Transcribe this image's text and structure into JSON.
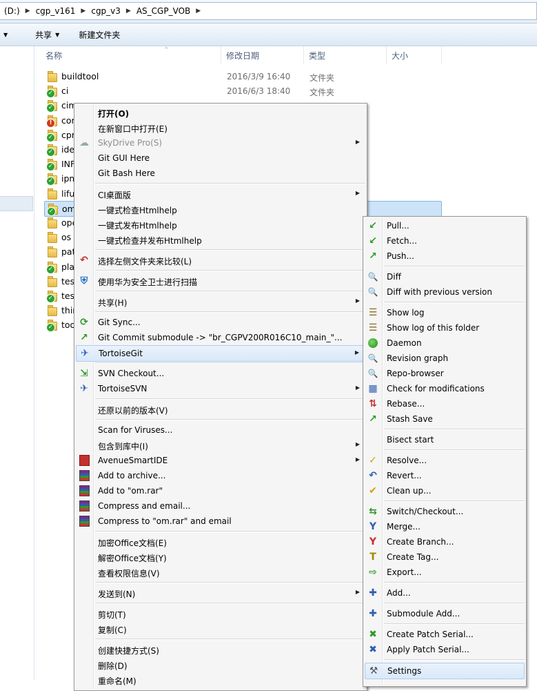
{
  "address": {
    "crumbs": [
      "(D:)",
      "cgp_v161",
      "cgp_v3",
      "AS_CGP_VOB"
    ]
  },
  "toolbar": {
    "share_label": "共享",
    "new_folder_label": "新建文件夹"
  },
  "columns": {
    "name": "名称",
    "date": "修改日期",
    "type": "类型",
    "size": "大小"
  },
  "files": [
    {
      "name": "buildtool",
      "date": "2016/3/9 16:40",
      "type": "文件夹",
      "status": "none"
    },
    {
      "name": "ci",
      "date": "2016/6/3 18:40",
      "type": "文件夹",
      "status": "ok"
    },
    {
      "name": "cim",
      "date": "",
      "type": "",
      "status": "ok"
    },
    {
      "name": "cor",
      "date": "",
      "type": "",
      "status": "modified"
    },
    {
      "name": "cpr",
      "date": "",
      "type": "",
      "status": "ok"
    },
    {
      "name": "ide",
      "date": "",
      "type": "",
      "status": "ok"
    },
    {
      "name": "INF",
      "date": "",
      "type": "",
      "status": "ok"
    },
    {
      "name": "ipm",
      "date": "",
      "type": "",
      "status": "ok"
    },
    {
      "name": "lifu",
      "date": "",
      "type": "",
      "status": "none"
    },
    {
      "name": "om",
      "date": "",
      "type": "",
      "status": "ok",
      "selected": true
    },
    {
      "name": "ope",
      "date": "",
      "type": "",
      "status": "none"
    },
    {
      "name": "os",
      "date": "",
      "type": "",
      "status": "none"
    },
    {
      "name": "pat",
      "date": "",
      "type": "",
      "status": "none"
    },
    {
      "name": "pla",
      "date": "",
      "type": "",
      "status": "ok"
    },
    {
      "name": "tes",
      "date": "",
      "type": "",
      "status": "none"
    },
    {
      "name": "tes",
      "date": "",
      "type": "",
      "status": "ok"
    },
    {
      "name": "thir",
      "date": "",
      "type": "",
      "status": "none"
    },
    {
      "name": "too",
      "date": "",
      "type": "",
      "status": "ok"
    }
  ],
  "context_menu": {
    "items": [
      {
        "label": "打开(O)",
        "bold": true,
        "icon": ""
      },
      {
        "label": "在新窗口中打开(E)",
        "icon": ""
      },
      {
        "label": "SkyDrive Pro(S)",
        "disabled": true,
        "submenu": true,
        "icon": "cloud-icon"
      },
      {
        "label": "Git GUI Here",
        "icon": ""
      },
      {
        "label": "Git Bash Here",
        "icon": ""
      },
      {
        "sep": true
      },
      {
        "label": "CI桌面版",
        "submenu": true,
        "icon": ""
      },
      {
        "label": "一键式检查Htmlhelp",
        "icon": ""
      },
      {
        "label": "一键式发布Htmlhelp",
        "icon": ""
      },
      {
        "label": "一键式检查并发布Htmlhelp",
        "icon": ""
      },
      {
        "sep": true
      },
      {
        "label": "选择左侧文件夹来比较(L)",
        "icon": "compare-icon"
      },
      {
        "sep": true
      },
      {
        "label": "使用华为安全卫士进行扫描",
        "icon": "shield-icon"
      },
      {
        "sep": true
      },
      {
        "label": "共享(H)",
        "submenu": true,
        "icon": ""
      },
      {
        "sep": true
      },
      {
        "label": "Git Sync...",
        "icon": "git-sync-icon"
      },
      {
        "label": "Git Commit submodule -> \"br_CGPV200R016C10_main_\"...",
        "icon": "git-commit-icon"
      },
      {
        "label": "TortoiseGit",
        "submenu": true,
        "highlighted": true,
        "icon": "tortoisegit-icon"
      },
      {
        "sep": true
      },
      {
        "label": "SVN Checkout...",
        "icon": "svn-checkout-icon"
      },
      {
        "label": "TortoiseSVN",
        "submenu": true,
        "icon": "tortoisesvn-icon"
      },
      {
        "sep": true
      },
      {
        "label": "还原以前的版本(V)",
        "icon": ""
      },
      {
        "sep": true
      },
      {
        "label": "Scan for Viruses...",
        "icon": ""
      },
      {
        "label": "包含到库中(I)",
        "submenu": true,
        "icon": ""
      },
      {
        "label": "AvenueSmartIDE",
        "submenu": true,
        "icon": "avenue-icon"
      },
      {
        "label": "Add to archive...",
        "icon": "winrar-icon"
      },
      {
        "label": "Add to \"om.rar\"",
        "icon": "winrar-icon"
      },
      {
        "label": "Compress and email...",
        "icon": "winrar-icon"
      },
      {
        "label": "Compress to \"om.rar\" and email",
        "icon": "winrar-icon"
      },
      {
        "sep": true
      },
      {
        "label": "加密Office文档(E)",
        "icon": ""
      },
      {
        "label": "解密Office文档(Y)",
        "icon": ""
      },
      {
        "label": "查看权限信息(V)",
        "icon": ""
      },
      {
        "sep": true
      },
      {
        "label": "发送到(N)",
        "submenu": true,
        "icon": ""
      },
      {
        "sep": true
      },
      {
        "label": "剪切(T)",
        "icon": ""
      },
      {
        "label": "复制(C)",
        "icon": ""
      },
      {
        "sep": true
      },
      {
        "label": "创建快捷方式(S)",
        "icon": ""
      },
      {
        "label": "删除(D)",
        "icon": ""
      },
      {
        "label": "重命名(M)",
        "icon": ""
      }
    ]
  },
  "git_submenu": {
    "items": [
      {
        "label": "Pull...",
        "icon": "pull-icon"
      },
      {
        "label": "Fetch...",
        "icon": "fetch-icon"
      },
      {
        "label": "Push...",
        "icon": "push-icon"
      },
      {
        "sep": true
      },
      {
        "label": "Diff",
        "icon": "diff-icon"
      },
      {
        "label": "Diff with previous version",
        "icon": "diff-icon"
      },
      {
        "sep": true
      },
      {
        "label": "Show log",
        "icon": "log-icon"
      },
      {
        "label": "Show log of this folder",
        "icon": "log-icon"
      },
      {
        "label": "Daemon",
        "icon": "daemon-icon"
      },
      {
        "label": "Revision graph",
        "icon": "revision-graph-icon"
      },
      {
        "label": "Repo-browser",
        "icon": "repo-browser-icon"
      },
      {
        "label": "Check for modifications",
        "icon": "check-modifications-icon"
      },
      {
        "label": "Rebase...",
        "icon": "rebase-icon"
      },
      {
        "label": "Stash Save",
        "icon": "stash-icon"
      },
      {
        "sep": true
      },
      {
        "label": "Bisect start",
        "icon": ""
      },
      {
        "sep": true
      },
      {
        "label": "Resolve...",
        "icon": "resolve-icon"
      },
      {
        "label": "Revert...",
        "icon": "revert-icon"
      },
      {
        "label": "Clean up...",
        "icon": "cleanup-icon"
      },
      {
        "sep": true
      },
      {
        "label": "Switch/Checkout...",
        "icon": "switch-icon"
      },
      {
        "label": "Merge...",
        "icon": "merge-icon"
      },
      {
        "label": "Create Branch...",
        "icon": "branch-icon"
      },
      {
        "label": "Create Tag...",
        "icon": "tag-icon"
      },
      {
        "label": "Export...",
        "icon": "export-icon"
      },
      {
        "sep": true
      },
      {
        "label": "Add...",
        "icon": "add-icon"
      },
      {
        "sep": true
      },
      {
        "label": "Submodule Add...",
        "icon": "submodule-add-icon"
      },
      {
        "sep": true
      },
      {
        "label": "Create Patch Serial...",
        "icon": "patch-create-icon"
      },
      {
        "label": "Apply Patch Serial...",
        "icon": "patch-apply-icon"
      },
      {
        "sep": true
      },
      {
        "label": "Settings",
        "highlighted": true,
        "icon": "settings-icon"
      }
    ]
  }
}
